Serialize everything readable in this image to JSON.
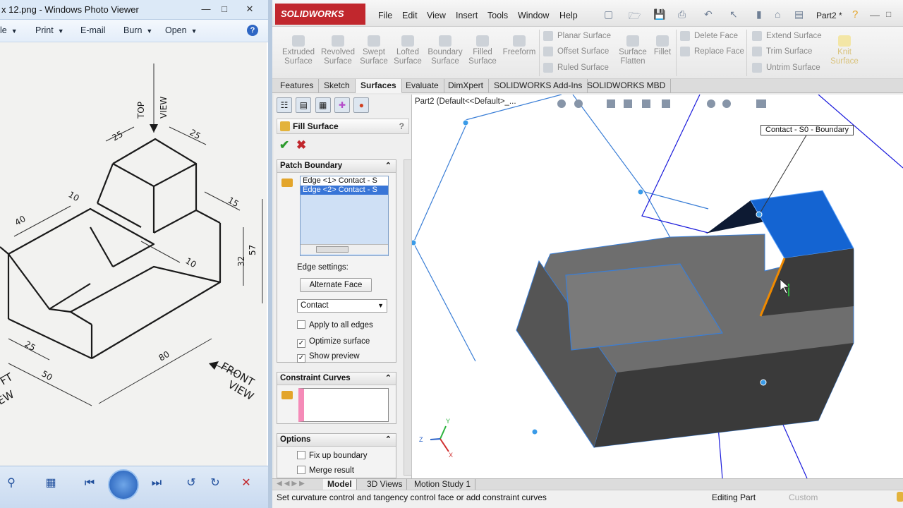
{
  "photo_viewer": {
    "title": "x 12.png - Windows Photo Viewer",
    "menu": [
      "le",
      "Print",
      "E-mail",
      "Burn",
      "Open"
    ],
    "help": "?",
    "drawing_labels": {
      "top_view": "TOP\nVIEW",
      "front_view": "FRONT\nVIEW",
      "left_view": "FT\nEW",
      "dims": [
        "25",
        "25",
        "10",
        "40",
        "15",
        "57",
        "32",
        "10",
        "25",
        "50",
        "80"
      ]
    }
  },
  "sw": {
    "brand": "SOLIDWORKS",
    "menu": [
      "File",
      "Edit",
      "View",
      "Insert",
      "Tools",
      "Window",
      "Help"
    ],
    "doc_title": "Part2 *",
    "ribbon": {
      "big": [
        {
          "label": "Extruded\nSurface"
        },
        {
          "label": "Revolved\nSurface"
        },
        {
          "label": "Swept\nSurface"
        },
        {
          "label": "Lofted\nSurface"
        },
        {
          "label": "Boundary\nSurface"
        },
        {
          "label": "Filled\nSurface"
        },
        {
          "label": "Freeform"
        },
        {
          "label": "Surface\nFlatten"
        },
        {
          "label": "Fillet"
        },
        {
          "label": "Knit\nSurface"
        }
      ],
      "small": [
        "Planar Surface",
        "Offset Surface",
        "Ruled Surface",
        "Delete Face",
        "Replace Face",
        "Extend Surface",
        "Trim Surface",
        "Untrim Surface"
      ]
    },
    "tabs": [
      "Features",
      "Sketch",
      "Surfaces",
      "Evaluate",
      "DimXpert",
      "SOLIDWORKS Add-Ins",
      "SOLIDWORKS MBD"
    ],
    "active_tab": "Surfaces",
    "property_manager": {
      "title": "Fill Surface",
      "help": "?",
      "patch_boundary": {
        "header": "Patch Boundary",
        "items": [
          "Edge <1> Contact - S",
          "Edge <2> Contact - S"
        ],
        "edge_settings_label": "Edge settings:",
        "alternate_face": "Alternate Face",
        "contact_select": "Contact",
        "apply_all": {
          "label": "Apply to all edges",
          "checked": false
        },
        "optimize": {
          "label": "Optimize surface",
          "checked": true
        },
        "show_preview": {
          "label": "Show preview",
          "checked": true
        }
      },
      "constraint_curves": {
        "header": "Constraint Curves"
      },
      "options": {
        "header": "Options",
        "fix_up": {
          "label": "Fix up boundary",
          "checked": false
        },
        "merge": {
          "label": "Merge result",
          "checked": false
        }
      }
    },
    "viewport": {
      "breadcrumb": "Part2  (Default<<Default>_...",
      "callout": "Contact - S0 - Boundary",
      "triad": {
        "x": "X",
        "y": "Y",
        "z": "Z"
      }
    },
    "bottom_tabs": [
      "Model",
      "3D Views",
      "Motion Study 1"
    ],
    "active_bottom_tab": "Model",
    "status": {
      "message": "Set curvature control and tangency control face or add constraint curves",
      "editing": "Editing Part",
      "custom": "Custom"
    },
    "colors": {
      "brand_red": "#c1272d",
      "selection_blue": "#0066cc",
      "edge_orange": "#f08a00",
      "model_gray": "#6d6d6d"
    }
  }
}
